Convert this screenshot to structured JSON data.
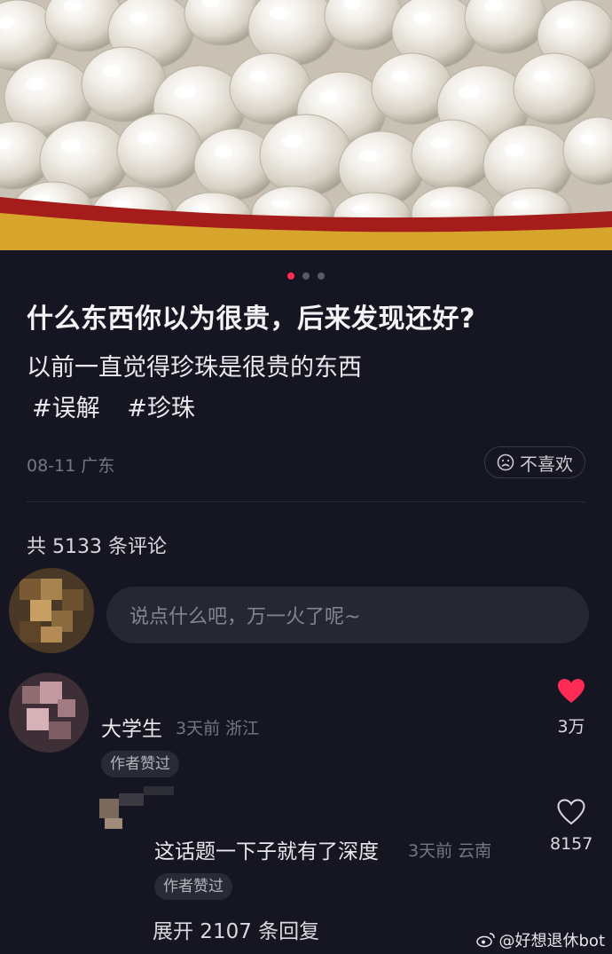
{
  "post": {
    "title": "什么东西你以为很贵，后来发现还好?",
    "description": "以前一直觉得珍珠是很贵的东西",
    "tags": [
      "#误解",
      "#珍珠"
    ],
    "date_location": "08-11 广东",
    "dislike_label": "不喜欢",
    "image_count": 3,
    "current_image": 1
  },
  "comments_header": {
    "count_text": "共 5133 条评论"
  },
  "comment_input": {
    "placeholder": "说点什么吧，万一火了呢~"
  },
  "comments": [
    {
      "username": "大学生",
      "meta": "3天前 浙江",
      "badge": "作者赞过",
      "likes": "3万",
      "liked": true
    },
    {
      "text": "这话题一下子就有了深度",
      "meta": "3天前 云南",
      "badge": "作者赞过",
      "likes": "8157",
      "liked": false
    }
  ],
  "expand_replies": "展开 2107 条回复",
  "watermark": "@好想退休bot",
  "colors": {
    "background": "#161622",
    "accent_red": "#fe2c55",
    "muted_text": "#77777f"
  }
}
